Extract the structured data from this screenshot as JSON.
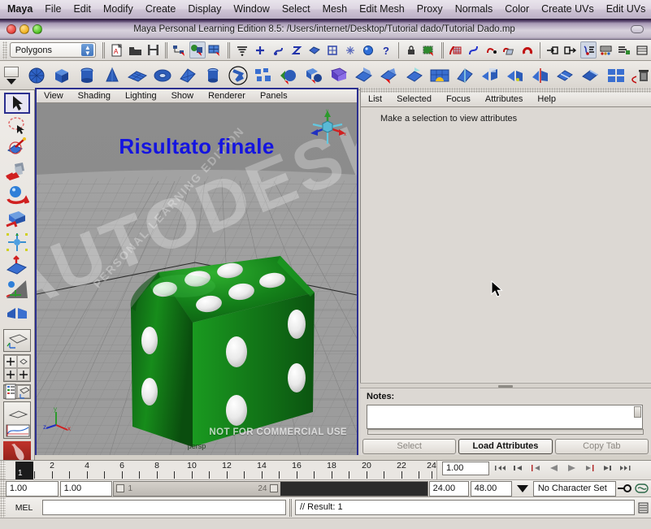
{
  "osx_menubar": {
    "items": [
      {
        "label": "Maya",
        "bold": true
      },
      {
        "label": "File"
      },
      {
        "label": "Edit"
      },
      {
        "label": "Modify"
      },
      {
        "label": "Create"
      },
      {
        "label": "Display"
      },
      {
        "label": "Window"
      },
      {
        "label": "Select"
      },
      {
        "label": "Mesh"
      },
      {
        "label": "Edit Mesh"
      },
      {
        "label": "Proxy"
      },
      {
        "label": "Normals"
      },
      {
        "label": "Color"
      },
      {
        "label": "Create UVs"
      },
      {
        "label": "Edit UVs"
      }
    ]
  },
  "window": {
    "title": "Maya Personal Learning Edition 8.5: /Users/internet/Desktop/Tutorial dado/Tutorial Dado.mp"
  },
  "statusline": {
    "menuset": "Polygons",
    "icons": [
      {
        "name": "new-scene-icon"
      },
      {
        "name": "open-scene-icon"
      },
      {
        "name": "save-scene-icon"
      },
      {
        "name": "select-by-hierarchy-icon"
      },
      {
        "name": "select-by-object-icon"
      },
      {
        "name": "select-by-component-icon"
      },
      {
        "name": "component-mask-icon"
      },
      {
        "name": "points-mask-icon"
      },
      {
        "name": "lines-mask-icon"
      },
      {
        "name": "curves-mask-icon"
      },
      {
        "name": "surfaces-mask-icon"
      },
      {
        "name": "deformation-mask-icon"
      },
      {
        "name": "dynamics-mask-icon"
      },
      {
        "name": "rendering-mask-icon"
      },
      {
        "name": "misc-mask-icon"
      },
      {
        "name": "lock-icon"
      },
      {
        "name": "highlight-selection-icon"
      },
      {
        "name": "snap-to-grid-icon"
      },
      {
        "name": "snap-to-curve-icon"
      },
      {
        "name": "snap-to-point-icon"
      },
      {
        "name": "snap-to-view-plane-icon"
      },
      {
        "name": "snap-to-magnet-icon"
      },
      {
        "name": "input-connections-icon"
      },
      {
        "name": "output-connections-icon"
      },
      {
        "name": "construction-history-icon"
      },
      {
        "name": "render-current-frame-icon"
      },
      {
        "name": "ipr-render-icon"
      },
      {
        "name": "render-settings-icon"
      }
    ]
  },
  "shelf": {
    "items": [
      {
        "name": "poly-sphere-icon"
      },
      {
        "name": "poly-cube-icon"
      },
      {
        "name": "poly-cylinder-icon"
      },
      {
        "name": "poly-cone-icon"
      },
      {
        "name": "poly-plane-icon"
      },
      {
        "name": "poly-torus-icon"
      },
      {
        "name": "poly-prism-icon"
      },
      {
        "name": "poly-pipe-icon"
      },
      {
        "name": "poly-helix-icon"
      },
      {
        "name": "poly-soccer-ball-icon"
      },
      {
        "name": "poly-combine-icon"
      },
      {
        "name": "poly-booleans-icon"
      },
      {
        "name": "poly-smooth-icon"
      },
      {
        "name": "poly-triangulate-icon"
      },
      {
        "name": "poly-extrude-face-icon"
      },
      {
        "name": "poly-extrude-edge-icon"
      },
      {
        "name": "poly-bevel-icon"
      },
      {
        "name": "poly-bridge-icon"
      },
      {
        "name": "poly-append-icon"
      },
      {
        "name": "poly-wedge-icon"
      },
      {
        "name": "poly-split-polygon-icon"
      },
      {
        "name": "poly-cut-faces-icon"
      },
      {
        "name": "poly-insert-edge-loop-icon"
      },
      {
        "name": "poly-offset-edge-loop-icon"
      },
      {
        "name": "poly-merge-vertex-icon"
      },
      {
        "name": "poly-collapse-icon"
      },
      {
        "name": "poly-sculpt-icon"
      },
      {
        "name": "poly-paint-tool-icon"
      },
      {
        "name": "shelf-trash-icon"
      }
    ]
  },
  "toolbox": {
    "tools": [
      {
        "name": "select-tool",
        "selected": true
      },
      {
        "name": "lasso-tool",
        "selected": false
      },
      {
        "name": "paint-selection-tool",
        "selected": false
      },
      {
        "name": "move-tool",
        "selected": false
      },
      {
        "name": "rotate-tool",
        "selected": false
      },
      {
        "name": "scale-tool",
        "selected": false
      },
      {
        "name": "universal-manipulator-tool",
        "selected": false
      },
      {
        "name": "soft-modification-tool",
        "selected": false
      },
      {
        "name": "show-manipulator-tool",
        "selected": false
      },
      {
        "name": "last-tool-used",
        "selected": false
      }
    ],
    "layouts": [
      {
        "name": "single-perspective-layout"
      },
      {
        "name": "four-view-layout"
      },
      {
        "name": "outliner-persp-layout"
      },
      {
        "name": "persp-graph-layout"
      },
      {
        "name": "maya-logo-badge"
      }
    ]
  },
  "viewport": {
    "menu": [
      "View",
      "Shading",
      "Lighting",
      "Show",
      "Renderer",
      "Panels"
    ],
    "overlay_title": "Risultato finale",
    "watermark_large": "AUTODESK",
    "watermark_diagonal": "PERSONAL LEARNING EDITION",
    "commercial_notice": "NOT FOR COMMERCIAL USE",
    "camera_label": "persp",
    "axis_labels": {
      "x": "x",
      "y": "y",
      "z": "z"
    },
    "object_color": "#1f8a1f",
    "background_color": "#8f8f8f"
  },
  "attribute_editor": {
    "menu": [
      "List",
      "Selected",
      "Focus",
      "Attributes",
      "Help"
    ],
    "empty_message": "Make a selection to view attributes",
    "notes_label": "Notes:",
    "notes_value": "",
    "buttons": [
      {
        "label": "Select",
        "enabled": false
      },
      {
        "label": "Load Attributes",
        "enabled": true
      },
      {
        "label": "Copy Tab",
        "enabled": false
      }
    ]
  },
  "timeslider": {
    "current_frame": "1",
    "ticks": [
      2,
      4,
      6,
      8,
      10,
      12,
      14,
      16,
      18,
      20,
      22,
      24
    ],
    "current_time_field": "1.00",
    "playback_icons": [
      {
        "name": "go-to-start-icon"
      },
      {
        "name": "step-back-keyframe-icon"
      },
      {
        "name": "step-back-frame-icon"
      },
      {
        "name": "play-backwards-icon"
      },
      {
        "name": "play-forwards-icon"
      },
      {
        "name": "step-forward-frame-icon"
      },
      {
        "name": "step-forward-keyframe-icon"
      },
      {
        "name": "go-to-end-icon"
      }
    ]
  },
  "rangeslider": {
    "anim_start": "1.00",
    "range_start": "1.00",
    "bar_min_label": "1",
    "bar_max_label": "24",
    "range_end": "24.00",
    "anim_end": "48.00",
    "character_set": "No Character Set",
    "icons": [
      {
        "name": "auto-keyframe-icon"
      },
      {
        "name": "animation-preferences-icon"
      }
    ]
  },
  "commandline": {
    "label": "MEL",
    "input_value": "",
    "result_text": "// Result: 1",
    "menu_icon": "script-editor-icon"
  }
}
